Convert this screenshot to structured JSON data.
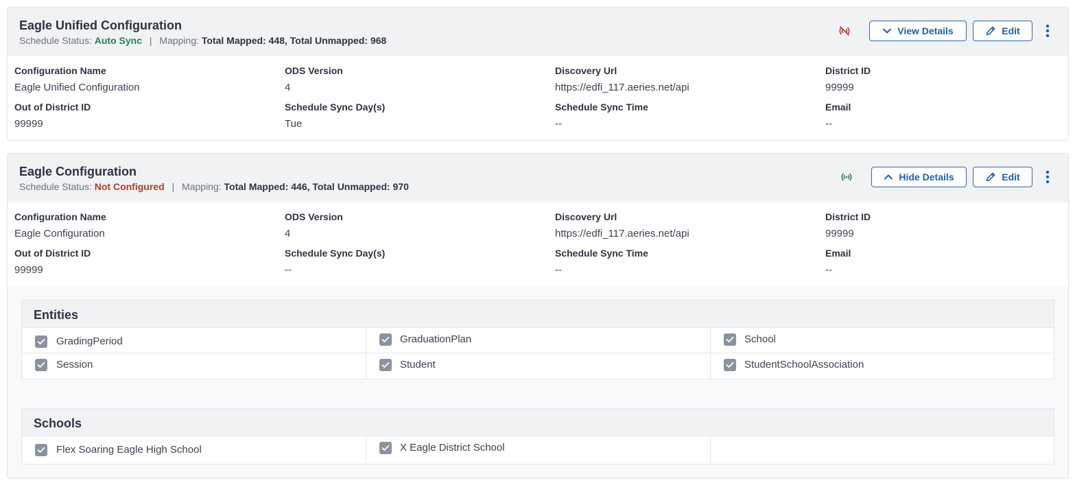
{
  "labels": {
    "schedule_status": "Schedule Status:",
    "mapping": "Mapping:",
    "separator": "|",
    "config_name": "Configuration Name",
    "ods_version": "ODS Version",
    "discovery_url": "Discovery Url",
    "district_id": "District ID",
    "out_of_district_id": "Out of District ID",
    "schedule_sync_days": "Schedule Sync Day(s)",
    "schedule_sync_time": "Schedule Sync Time",
    "email": "Email",
    "edit": "Edit"
  },
  "configs": [
    {
      "title": "Eagle Unified Configuration",
      "status": "Auto Sync",
      "status_color": "#2e7d4f",
      "mapping": "Total Mapped: 448, Total Unmapped: 968",
      "sync_icon": "sync-off-icon",
      "sync_icon_color": "#c0392b",
      "toggle_label": "View Details",
      "toggle_icon": "chevron-down-icon",
      "fields": {
        "config_name": "Eagle Unified Configuration",
        "ods_version": "4",
        "discovery_url": "https://edfi_117.aeries.net/api",
        "district_id": "99999",
        "out_of_district_id": "99999",
        "schedule_sync_days": "Tue",
        "schedule_sync_time": "--",
        "email": "--"
      }
    },
    {
      "title": "Eagle Configuration",
      "status": "Not Configured",
      "status_color": "#b23b2e",
      "mapping": "Total Mapped: 446, Total Unmapped: 970",
      "sync_icon": "sync-on-icon",
      "sync_icon_color": "#2e7d4f",
      "toggle_label": "Hide Details",
      "toggle_icon": "chevron-up-icon",
      "fields": {
        "config_name": "Eagle Configuration",
        "ods_version": "4",
        "discovery_url": "https://edfi_117.aeries.net/api",
        "district_id": "99999",
        "out_of_district_id": "99999",
        "schedule_sync_days": "--",
        "schedule_sync_time": "--",
        "email": "--"
      },
      "entities": {
        "title": "Entities",
        "items": [
          {
            "label": "GradingPeriod",
            "checked": true
          },
          {
            "label": "GraduationPlan",
            "checked": true
          },
          {
            "label": "School",
            "checked": true
          },
          {
            "label": "Session",
            "checked": true
          },
          {
            "label": "Student",
            "checked": true
          },
          {
            "label": "StudentSchoolAssociation",
            "checked": true
          }
        ]
      },
      "schools": {
        "title": "Schools",
        "items": [
          {
            "label": "Flex Soaring Eagle High School",
            "checked": true
          },
          {
            "label": "X Eagle District School",
            "checked": true
          }
        ]
      }
    }
  ]
}
